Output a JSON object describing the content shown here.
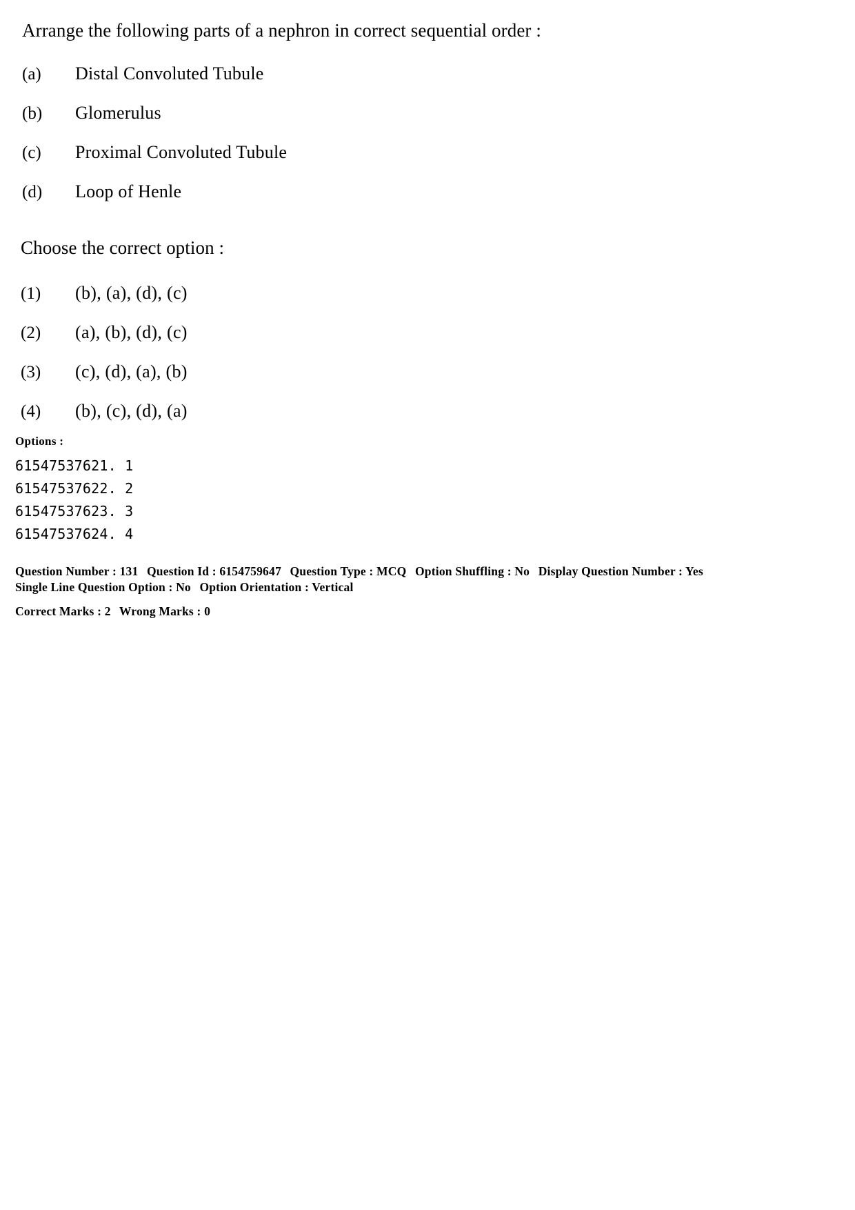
{
  "question": {
    "stem": "Arrange the following parts of a nephron in correct sequential order :",
    "items": [
      {
        "label": "(a)",
        "text": "Distal Convoluted Tubule"
      },
      {
        "label": "(b)",
        "text": "Glomerulus"
      },
      {
        "label": "(c)",
        "text": "Proximal Convoluted Tubule"
      },
      {
        "label": "(d)",
        "text": "Loop of Henle"
      }
    ],
    "choose_prompt": "Choose the correct option :",
    "choices": [
      {
        "label": "(1)",
        "text": "(b), (a), (d), (c)"
      },
      {
        "label": "(2)",
        "text": "(a), (b), (d), (c)"
      },
      {
        "label": "(3)",
        "text": "(c), (d), (a), (b)"
      },
      {
        "label": "(4)",
        "text": "(b), (c), (d), (a)"
      }
    ]
  },
  "options_block": {
    "title": "Options :",
    "lines": [
      "61547537621. 1",
      "61547537622. 2",
      "61547537623. 3",
      "61547537624. 4"
    ]
  },
  "meta": {
    "question_number_label": "Question Number :",
    "question_number_value": "131",
    "question_id_label": "Question Id :",
    "question_id_value": "6154759647",
    "question_type_label": "Question Type :",
    "question_type_value": "MCQ",
    "option_shuffling_label": "Option Shuffling :",
    "option_shuffling_value": "No",
    "display_question_number_label": "Display Question Number :",
    "display_question_number_value": "Yes",
    "single_line_question_option_label": "Single Line Question Option :",
    "single_line_question_option_value": "No",
    "option_orientation_label": "Option Orientation :",
    "option_orientation_value": "Vertical",
    "correct_marks_label": "Correct Marks :",
    "correct_marks_value": "2",
    "wrong_marks_label": "Wrong Marks :",
    "wrong_marks_value": "0"
  }
}
